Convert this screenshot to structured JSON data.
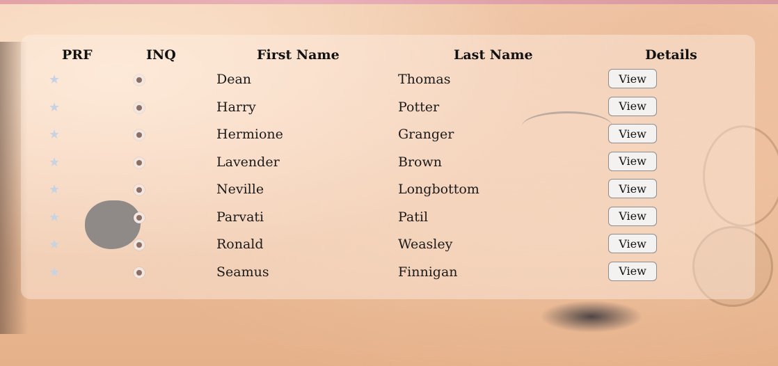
{
  "table": {
    "headers": {
      "prf": "PRF",
      "inq": "INQ",
      "first_name": "First Name",
      "last_name": "Last Name",
      "details": "Details"
    },
    "rows": [
      {
        "first": "Dean",
        "last": "Thomas",
        "action": "View"
      },
      {
        "first": "Harry",
        "last": "Potter",
        "action": "View"
      },
      {
        "first": "Hermione",
        "last": "Granger",
        "action": "View"
      },
      {
        "first": "Lavender",
        "last": "Brown",
        "action": "View"
      },
      {
        "first": "Neville",
        "last": "Longbottom",
        "action": "View"
      },
      {
        "first": "Parvati",
        "last": "Patil",
        "action": "View"
      },
      {
        "first": "Ronald",
        "last": "Weasley",
        "action": "View"
      },
      {
        "first": "Seamus",
        "last": "Finnigan",
        "action": "View"
      }
    ]
  },
  "icons": {
    "prf": "star-icon",
    "inq": "radio-icon"
  },
  "colors": {
    "star": "#c7d3e2",
    "radio_dot": "#8b6e64",
    "button_bg": "#f4f2f1"
  }
}
